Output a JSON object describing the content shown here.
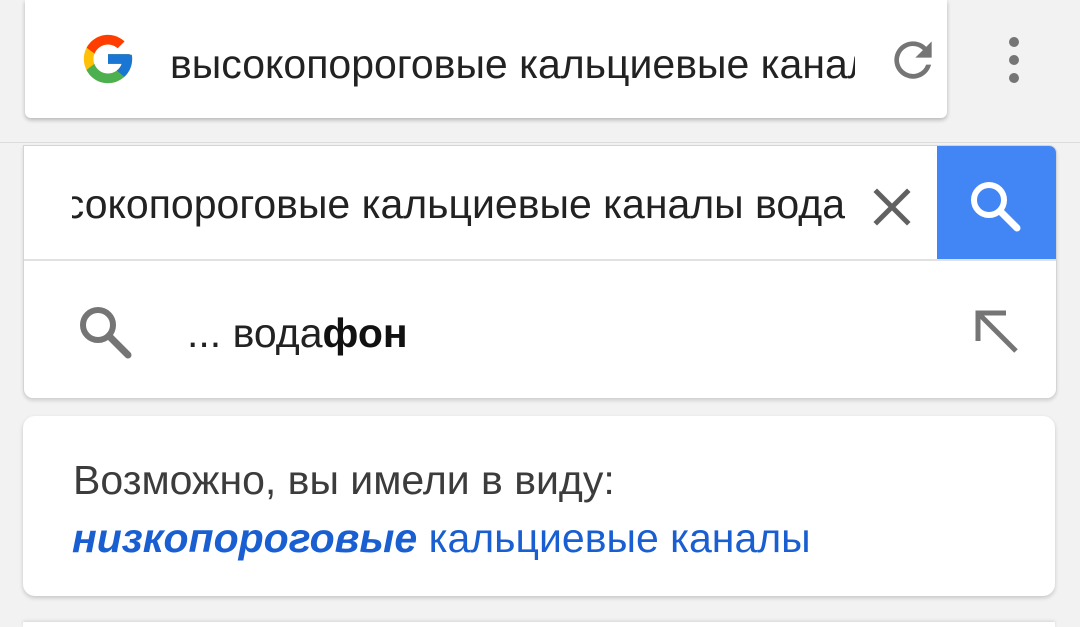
{
  "omnibox": {
    "url_text": "высокопороговые кальциевые каналы водафон",
    "icons": {
      "logo": "google-g-icon",
      "reload": "reload-icon",
      "menu": "more-vert-icon"
    }
  },
  "search": {
    "query": "высокопороговые кальциевые каналы вода",
    "icons": {
      "clear": "close-icon",
      "submit": "search-icon"
    },
    "button_color": "#4285f4"
  },
  "suggestion": {
    "prefix": "... вода",
    "completion": "фон",
    "icons": {
      "left": "search-icon",
      "right": "arrow-up-left-icon"
    }
  },
  "did_you_mean": {
    "label": "Возможно, вы имели в виду:",
    "emphasized": "низкопороговые",
    "rest": " кальциевые каналы",
    "link_color": "#1a5fd1"
  }
}
